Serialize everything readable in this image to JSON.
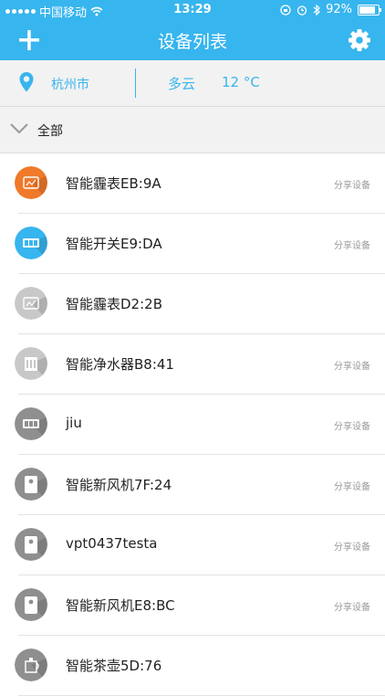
{
  "status_bar": {
    "carrier": "中国移动",
    "time": "13:29",
    "battery": "92%",
    "battery_level": 0.92
  },
  "nav": {
    "title": "设备列表",
    "add_icon": "plus-icon",
    "settings_icon": "gear-icon"
  },
  "weather": {
    "city": "杭州市",
    "condition": "多云",
    "temperature": "12 °C",
    "pin_icon": "location-pin-icon"
  },
  "group": {
    "label": "全部",
    "icon": "chevron-down-icon"
  },
  "devices": [
    {
      "name": "智能霾表EB:9A",
      "share": "分享设备",
      "icon": "air-monitor-icon",
      "color": "#f0792a"
    },
    {
      "name": "智能开关E9:DA",
      "share": "分享设备",
      "icon": "switch-icon",
      "color": "#37b5ee"
    },
    {
      "name": "智能霾表D2:2B",
      "share": "",
      "icon": "air-monitor-icon",
      "color": "#c8c8c8"
    },
    {
      "name": "智能净水器B8:41",
      "share": "分享设备",
      "icon": "water-purifier-icon",
      "color": "#c8c8c8"
    },
    {
      "name": "jiu",
      "share": "分享设备",
      "icon": "switch-icon",
      "color": "#8f8f8f"
    },
    {
      "name": "智能新风机7F:24",
      "share": "分享设备",
      "icon": "fresh-air-icon",
      "color": "#8f8f8f"
    },
    {
      "name": "vpt0437testa",
      "share": "分享设备",
      "icon": "fresh-air-icon",
      "color": "#8f8f8f"
    },
    {
      "name": "智能新风机E8:BC",
      "share": "分享设备",
      "icon": "fresh-air-icon",
      "color": "#8f8f8f"
    },
    {
      "name": "智能茶壶5D:76",
      "share": "",
      "icon": "teapot-icon",
      "color": "#8f8f8f"
    }
  ]
}
